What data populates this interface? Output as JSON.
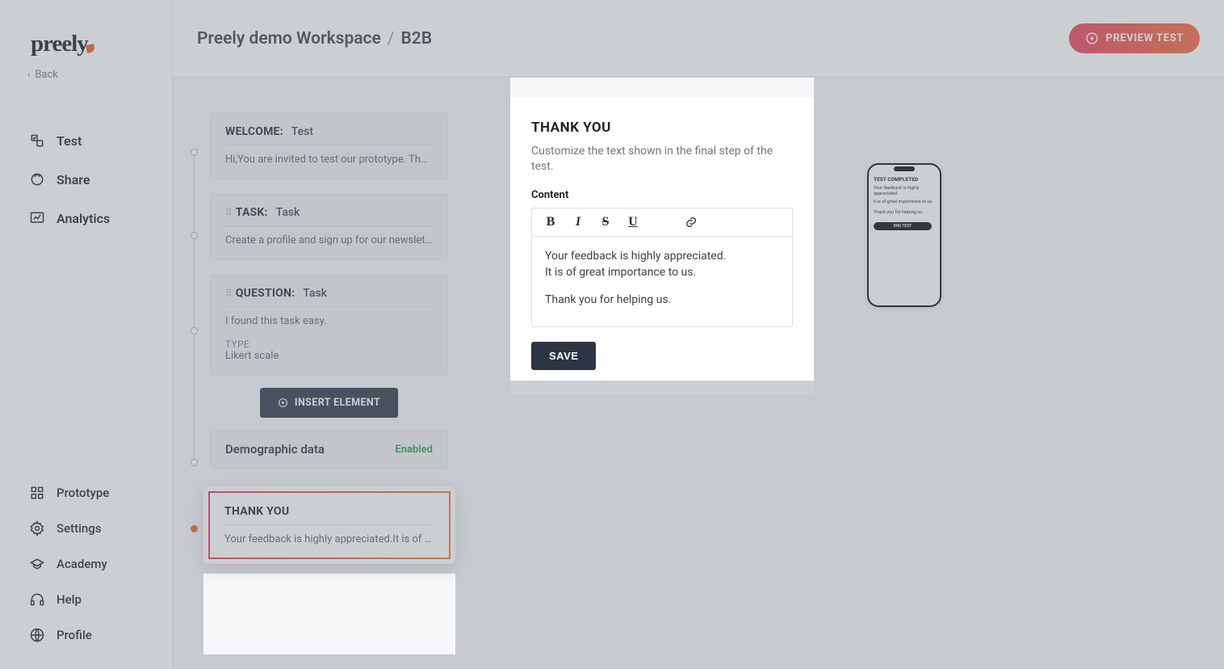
{
  "logo": {
    "text": "preely"
  },
  "back": {
    "label": "Back"
  },
  "sidebar": {
    "main_items": [
      {
        "label": "Test"
      },
      {
        "label": "Share"
      },
      {
        "label": "Analytics"
      }
    ],
    "bottom_items": [
      {
        "label": "Prototype"
      },
      {
        "label": "Settings"
      },
      {
        "label": "Academy"
      },
      {
        "label": "Help"
      },
      {
        "label": "Profile"
      }
    ]
  },
  "breadcrumb": {
    "workspace": "Preely demo Workspace",
    "sep": "/",
    "project": "B2B"
  },
  "preview_button": {
    "label": "PREVIEW TEST"
  },
  "steps": {
    "welcome": {
      "label": "WELCOME:",
      "value": "Test",
      "body": "Hi,You are invited to test our prototype. Thank …"
    },
    "task": {
      "label": "TASK:",
      "value": "Task",
      "body": "Create a profile and sign up for our newsletter."
    },
    "question": {
      "label": "QUESTION:",
      "value": "Task",
      "body": "I found this task easy.",
      "type_label": "TYPE",
      "type_value": "Likert scale"
    },
    "insert_button": {
      "label": "INSERT ELEMENT"
    },
    "demographic": {
      "title": "Demographic data",
      "status": "Enabled"
    },
    "thankyou": {
      "title": "THANK YOU",
      "body": "Your feedback is highly appreciated.It is of gre…"
    }
  },
  "editor": {
    "heading": "THANK YOU",
    "description": "Customize the text shown in the final step of the test.",
    "field_label": "Content",
    "toolbar": {
      "bold": "B",
      "italic": "I",
      "strike": "S",
      "underline": "U"
    },
    "content_line1": "Your feedback is highly appreciated.",
    "content_line2": "It is of great importance to us.",
    "content_line3": "Thank you for helping us.",
    "save_label": "SAVE"
  },
  "phone_preview": {
    "title": "TEST COMPLETED",
    "line1": "Your feedback is highly appreciated.",
    "line2": "It is of great importance to us.",
    "line3": "Thank you for helping us.",
    "button": "END TEST"
  }
}
